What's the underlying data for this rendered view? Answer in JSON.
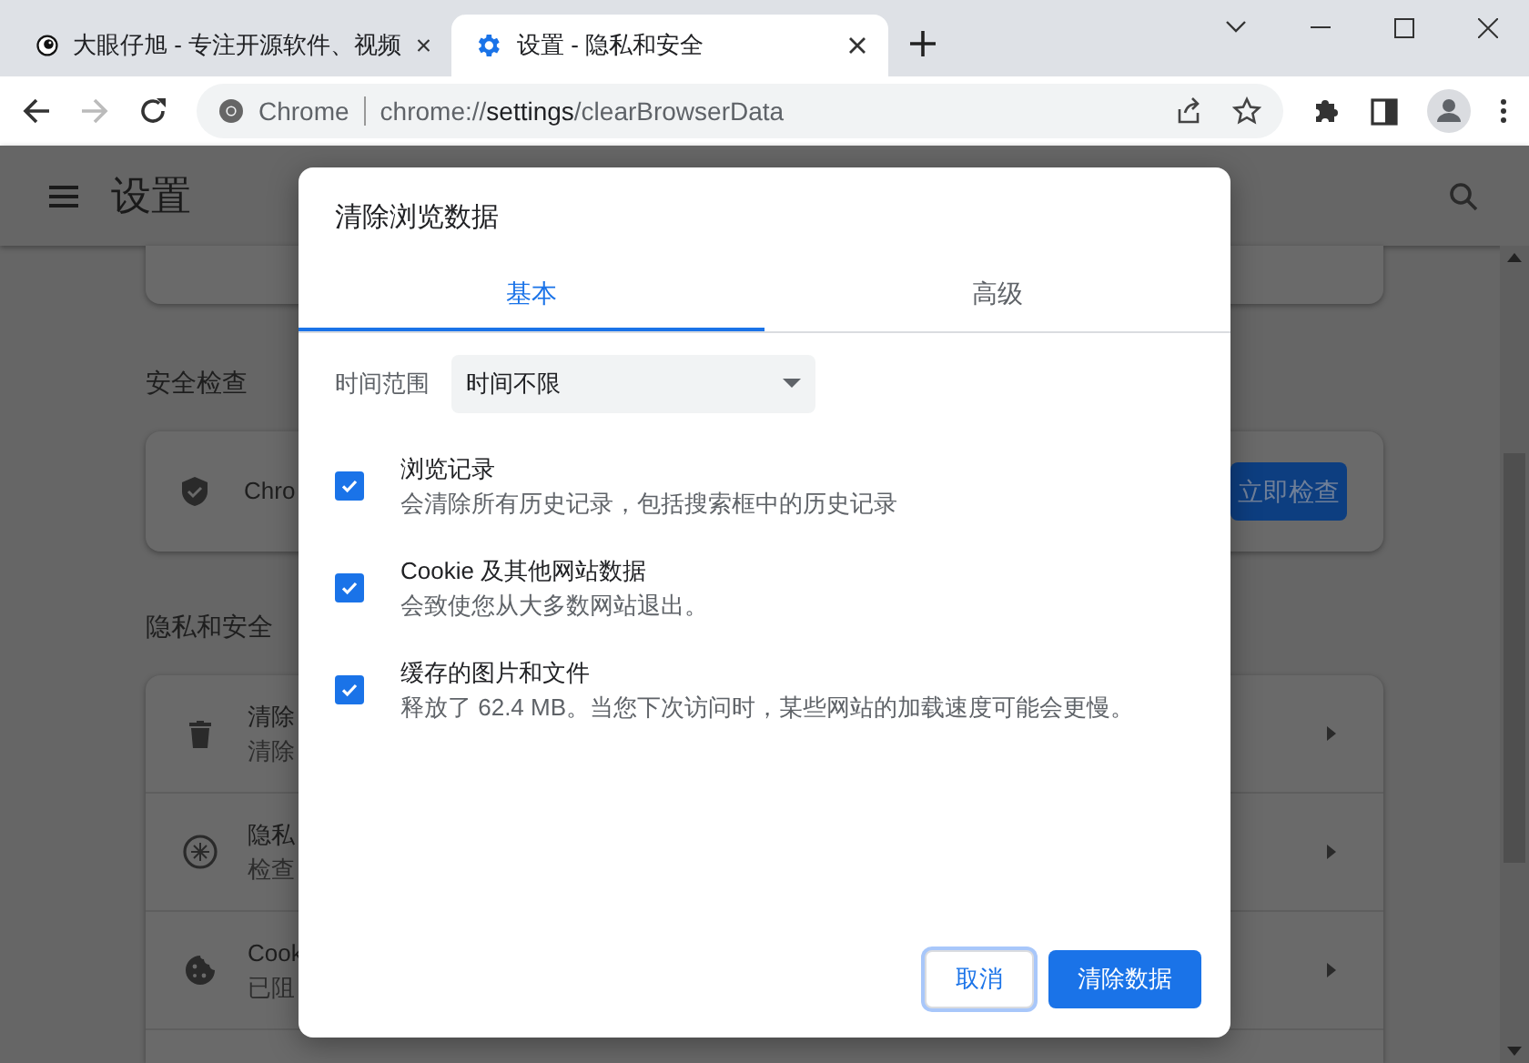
{
  "browser": {
    "tabs": [
      {
        "title": "大眼仔旭 - 专注开源软件、视频",
        "kind": "site",
        "selected": false
      },
      {
        "title": "设置 - 隐私和安全",
        "kind": "settings",
        "selected": true
      }
    ],
    "address_bar": {
      "site_label": "Chrome",
      "url_prefix": "chrome://",
      "url_host": "settings",
      "url_path": "/clearBrowserData"
    }
  },
  "settings": {
    "title": "设置",
    "safety_check": {
      "heading": "安全检查",
      "row_text": "Chro",
      "button": "立即检查"
    },
    "privacy": {
      "heading": "隐私和安全",
      "rows": [
        {
          "kind": "trash",
          "title": "清除",
          "subtitle": "清除"
        },
        {
          "kind": "compass",
          "title": "隐私",
          "subtitle": "检查"
        },
        {
          "kind": "cookie",
          "title": "Cook",
          "subtitle": "已阻"
        }
      ]
    }
  },
  "dialog": {
    "title": "清除浏览数据",
    "tabs": [
      {
        "label": "基本",
        "selected": true
      },
      {
        "label": "高级",
        "selected": false
      }
    ],
    "time_range": {
      "label": "时间范围",
      "value": "时间不限"
    },
    "options": [
      {
        "title": "浏览记录",
        "description": "会清除所有历史记录，包括搜索框中的历史记录",
        "checked": true
      },
      {
        "title": "Cookie 及其他网站数据",
        "description": "会致使您从大多数网站退出。",
        "checked": true
      },
      {
        "title": "缓存的图片和文件",
        "description": "释放了 62.4 MB。当您下次访问时，某些网站的加载速度可能会更慢。",
        "checked": true
      }
    ],
    "buttons": [
      {
        "label": "取消",
        "kind": "secondary"
      },
      {
        "label": "清除数据",
        "kind": "primary"
      }
    ]
  }
}
